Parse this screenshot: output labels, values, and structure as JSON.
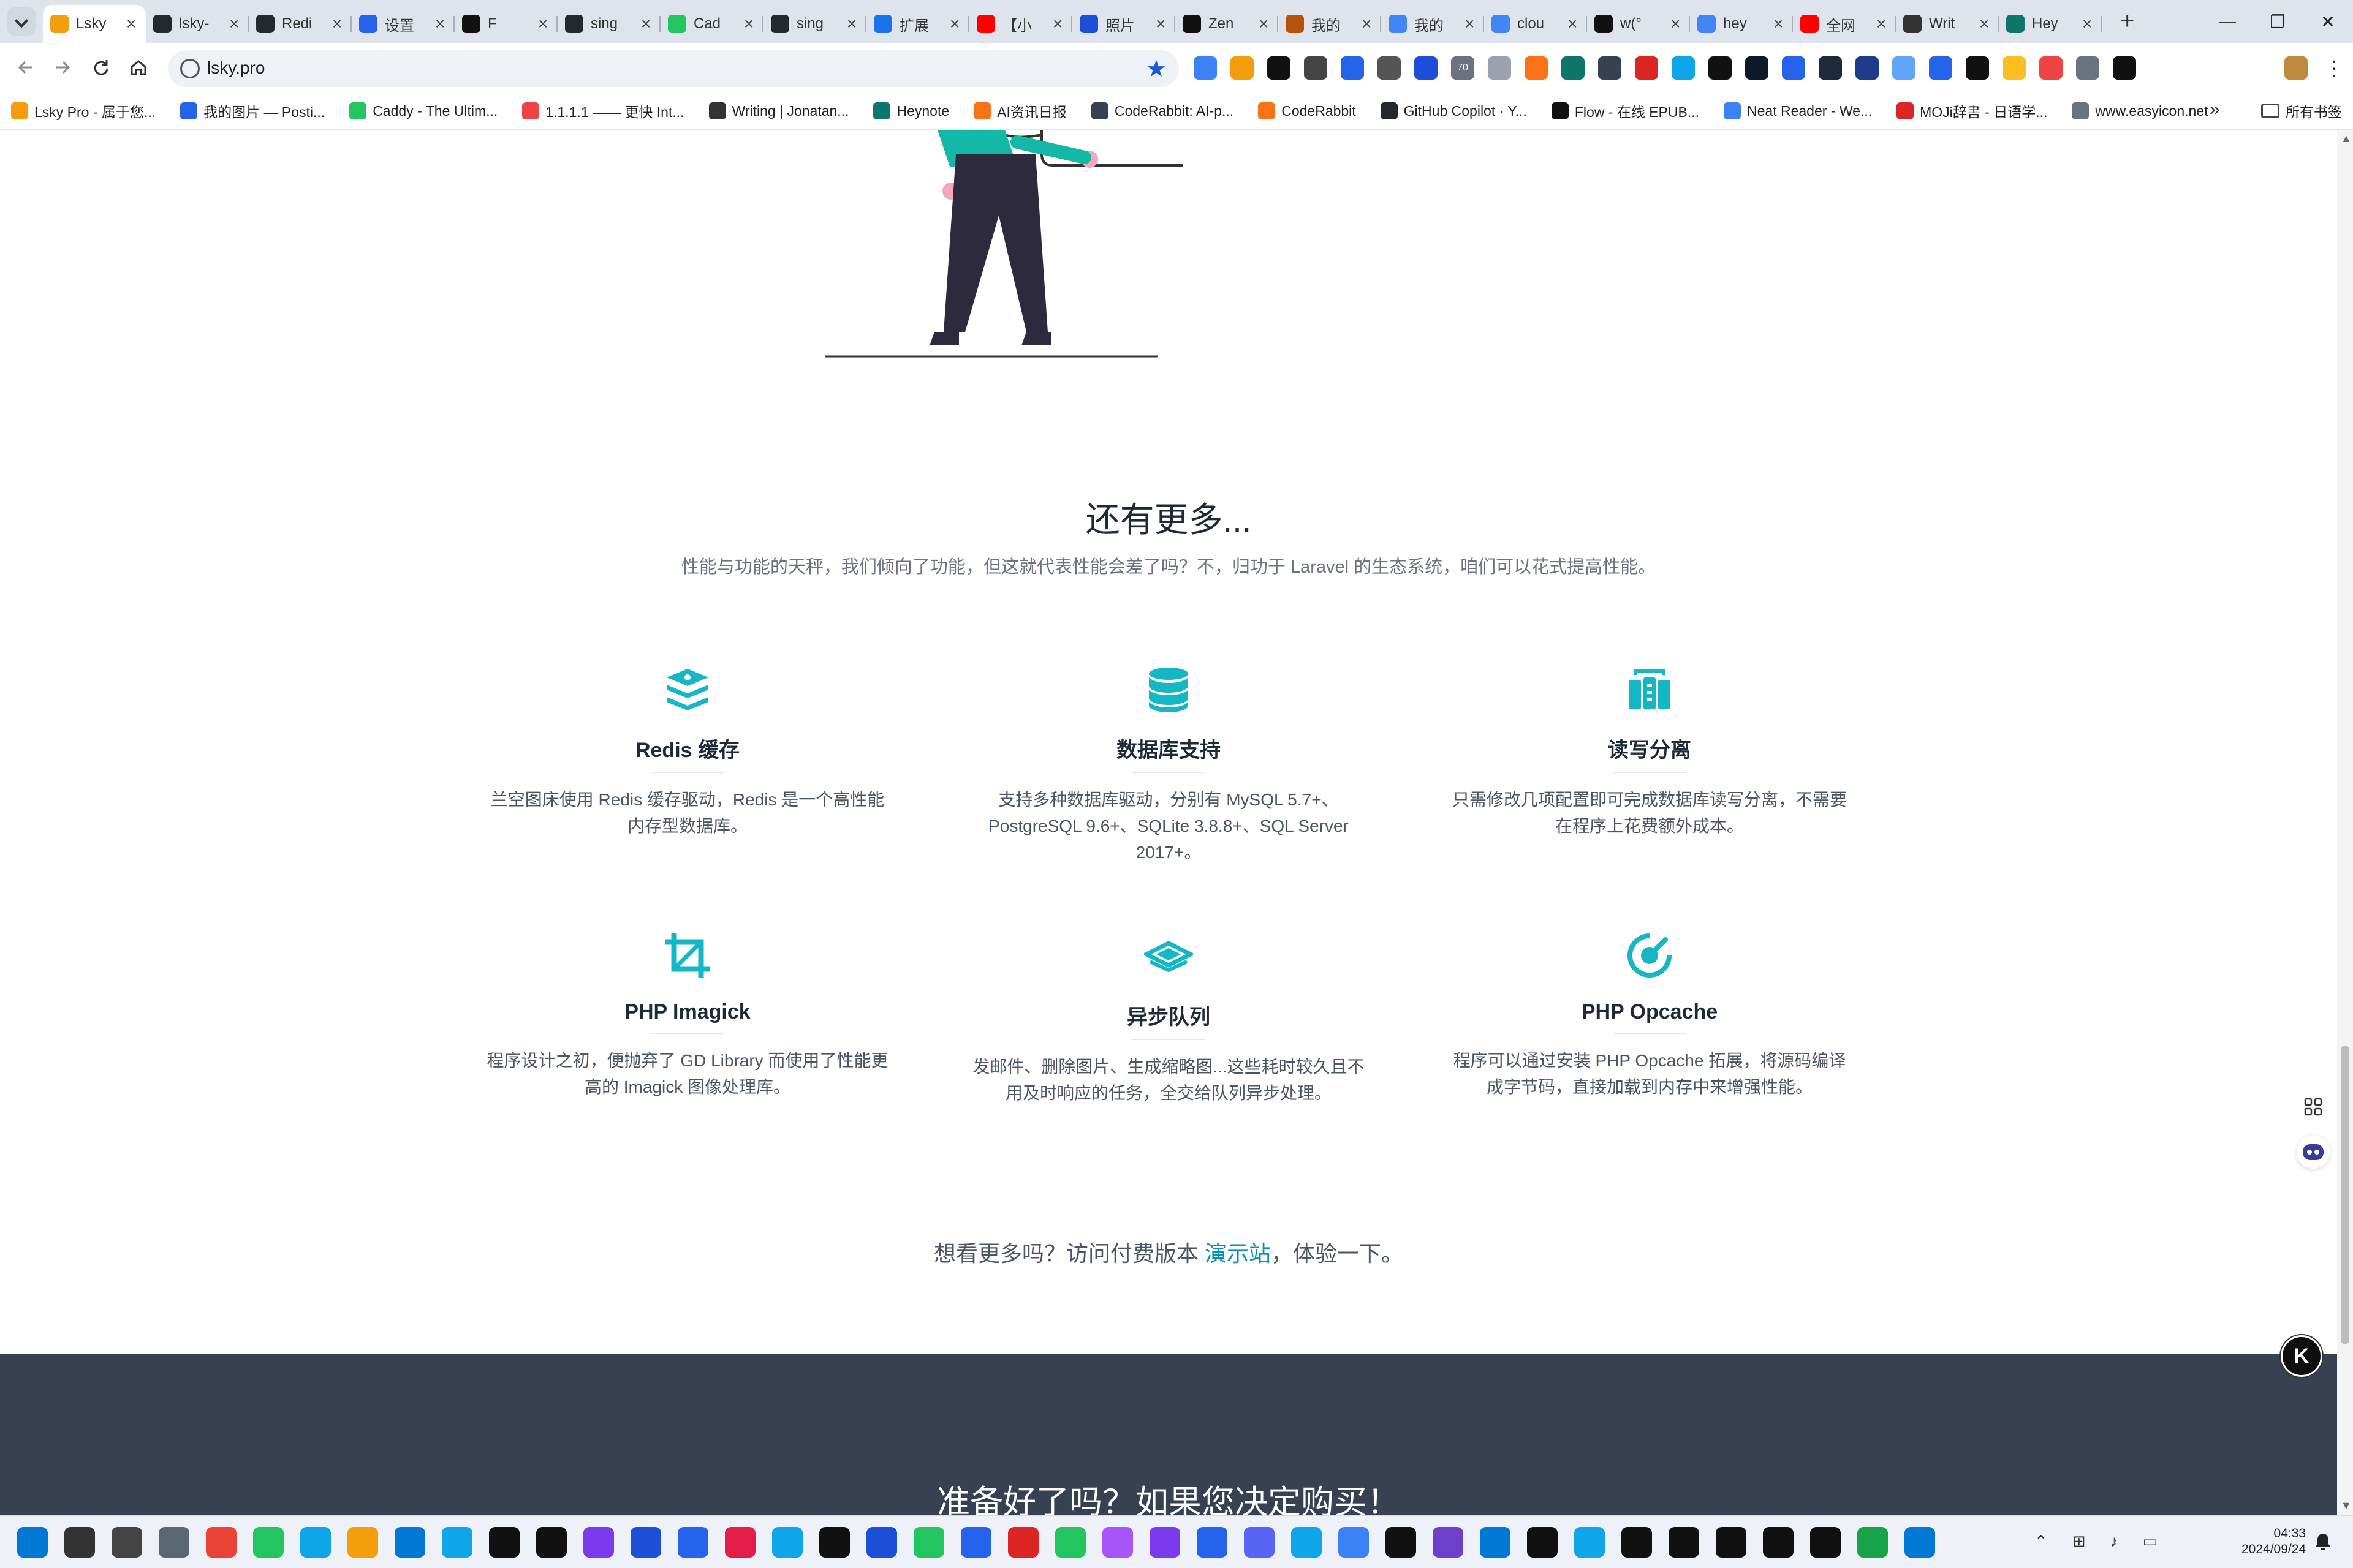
{
  "browser": {
    "tabs": [
      {
        "title": "Lsky",
        "color": "#f59e0b",
        "active": true
      },
      {
        "title": "lsky-",
        "color": "#24292f"
      },
      {
        "title": "Redi",
        "color": "#24292f"
      },
      {
        "title": "设置",
        "color": "#2563eb"
      },
      {
        "title": "F",
        "color": "#111111"
      },
      {
        "title": "sing",
        "color": "#24292f"
      },
      {
        "title": "Cad",
        "color": "#22c55e"
      },
      {
        "title": "sing",
        "color": "#24292f"
      },
      {
        "title": "扩展",
        "color": "#1a73e8"
      },
      {
        "title": "【小",
        "color": "#ff0000"
      },
      {
        "title": "照片",
        "color": "#1d4ed8"
      },
      {
        "title": "Zen",
        "color": "#111111"
      },
      {
        "title": "我的",
        "color": "#b45309"
      },
      {
        "title": "我的",
        "color": "#4285f4"
      },
      {
        "title": "clou",
        "color": "#4285f4"
      },
      {
        "title": "w(°",
        "color": "#111111"
      },
      {
        "title": "hey",
        "color": "#4285f4"
      },
      {
        "title": "全网",
        "color": "#ff0000"
      },
      {
        "title": "Writ",
        "color": "#333333"
      },
      {
        "title": "Hey",
        "color": "#0f766e"
      }
    ],
    "new_tab": "+",
    "window_controls": [
      "—",
      "❐",
      "✕"
    ],
    "url": "lsky.pro",
    "extension_badge": "70",
    "bookmarks": [
      {
        "label": "Lsky Pro - 属于您...",
        "color": "#f59e0b"
      },
      {
        "label": "我的图片 — Posti...",
        "color": "#2563eb"
      },
      {
        "label": "Caddy - The Ultim...",
        "color": "#22c55e"
      },
      {
        "label": "1.1.1.1 —— 更快 Int...",
        "color": "#ef4444"
      },
      {
        "label": "Writing | Jonatan...",
        "color": "#333333"
      },
      {
        "label": "Heynote",
        "color": "#0f766e"
      },
      {
        "label": "AI资讯日报",
        "color": "#f97316"
      },
      {
        "label": "CodeRabbit: AI-p...",
        "color": "#374151"
      },
      {
        "label": "CodeRabbit",
        "color": "#f97316"
      },
      {
        "label": "GitHub Copilot · Y...",
        "color": "#24292f"
      },
      {
        "label": "Flow - 在线 EPUB...",
        "color": "#111111"
      },
      {
        "label": "Neat Reader - We...",
        "color": "#3b82f6"
      },
      {
        "label": "MOJi辞書 - 日语学...",
        "color": "#dc2626"
      },
      {
        "label": "www.easyicon.net",
        "color": "#6b7280"
      }
    ],
    "bookmarks_more": "»",
    "all_bookmarks": "所有书签"
  },
  "page": {
    "more_title": "还有更多...",
    "more_subtitle": "性能与功能的天秤，我们倾向了功能，但这就代表性能会差了吗？不，归功于 Laravel 的生态系统，咱们可以花式提高性能。",
    "features": [
      {
        "icon": "layers-icon",
        "title": "Redis 缓存",
        "desc": "兰空图床使用 Redis 缓存驱动，Redis 是一个高性能内存型数据库。"
      },
      {
        "icon": "database-icon",
        "title": "数据库支持",
        "desc": "支持多种数据库驱动，分别有 MySQL 5.7+、PostgreSQL 9.6+、SQLite 3.8.8+、SQL Server 2017+。"
      },
      {
        "icon": "server-split-icon",
        "title": "读写分离",
        "desc": "只需修改几项配置即可完成数据库读写分离，不需要在程序上花费额外成本。"
      },
      {
        "icon": "crop-icon",
        "title": "PHP Imagick",
        "desc": "程序设计之初，便抛弃了 GD Library 而使用了性能更高的 Imagick 图像处理库。"
      },
      {
        "icon": "queue-icon",
        "title": "异步队列",
        "desc": "发邮件、删除图片、生成缩略图...这些耗时较久且不用及时响应的任务，全交给队列异步处理。"
      },
      {
        "icon": "speedometer-icon",
        "title": "PHP Opcache",
        "desc": "程序可以通过安装 PHP Opcache 拓展，将源码编译成字节码，直接加载到内存中来增强性能。"
      }
    ],
    "cta_prefix": "想看更多吗？访问付费版本 ",
    "cta_link": "演示站",
    "cta_suffix": "，体验一下。",
    "dark_title": "准备好了吗？如果您决定购买！",
    "float_button": "K",
    "accent_color": "#14b8c4"
  },
  "taskbar": {
    "time": "04:33",
    "date": "2024/09/24",
    "apps": [
      "#0078d4",
      "#333333",
      "#444444",
      "#5b6770",
      "#ea4335",
      "#22c55e",
      "#0ea5e9",
      "#f59e0b",
      "#0078d4",
      "#0ea5e9",
      "#111111",
      "#111111",
      "#7c3aed",
      "#1d4ed8",
      "#2563eb",
      "#e11d48",
      "#0ea5e9",
      "#111111",
      "#1d4ed8",
      "#22c55e",
      "#2563eb",
      "#dc2626",
      "#22c55e",
      "#a855f7",
      "#7c3aed",
      "#2563eb",
      "#5865f2",
      "#0ea5e9",
      "#3b82f6",
      "#111111",
      "#6e40c9",
      "#0078d4",
      "#111111",
      "#0ea5e9",
      "#111111",
      "#111111",
      "#111111",
      "#111111",
      "#111111",
      "#16a34a",
      "#0078d4"
    ]
  }
}
